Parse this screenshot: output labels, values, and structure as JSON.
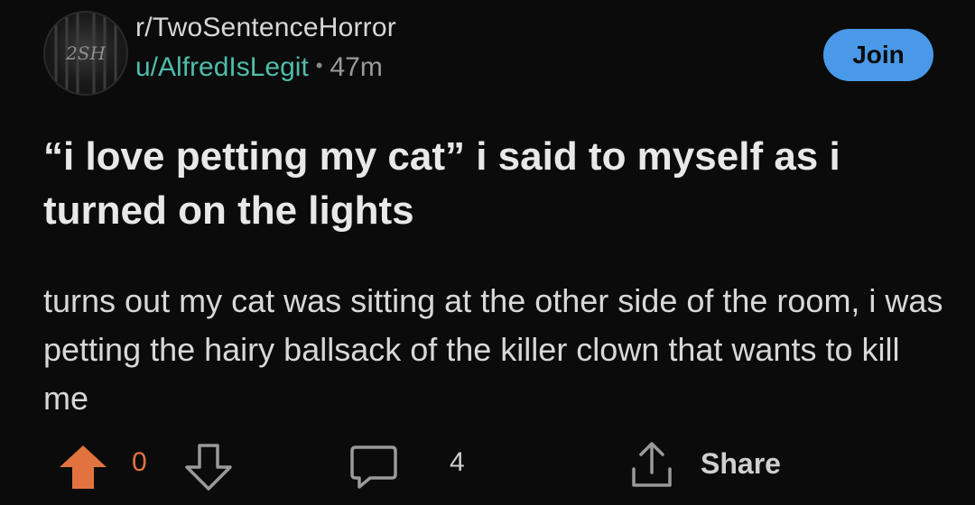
{
  "post": {
    "subreddit": "r/TwoSentenceHorror",
    "username": "u/AlfredIsLegit",
    "separator": "•",
    "age": "47m",
    "avatar_text": "2SH",
    "join_label": "Join",
    "title": "“i love petting my cat” i said to myself as i turned on the lights",
    "body": "turns out my cat was sitting at the other side of the room, i was petting the hairy ballsack of the killer clown that wants to kill me"
  },
  "actions": {
    "upvote_icon": "arrow-up-icon",
    "score": "0",
    "downvote_icon": "arrow-down-icon",
    "comment_icon": "speech-bubble-icon",
    "comment_count": "4",
    "share_icon": "share-icon",
    "share_label": "Share"
  },
  "colors": {
    "background": "#0b0b0b",
    "username": "#4fbcab",
    "join_button": "#4a99e8",
    "upvote_active": "#e2733f",
    "icon": "#9a9a9a"
  }
}
